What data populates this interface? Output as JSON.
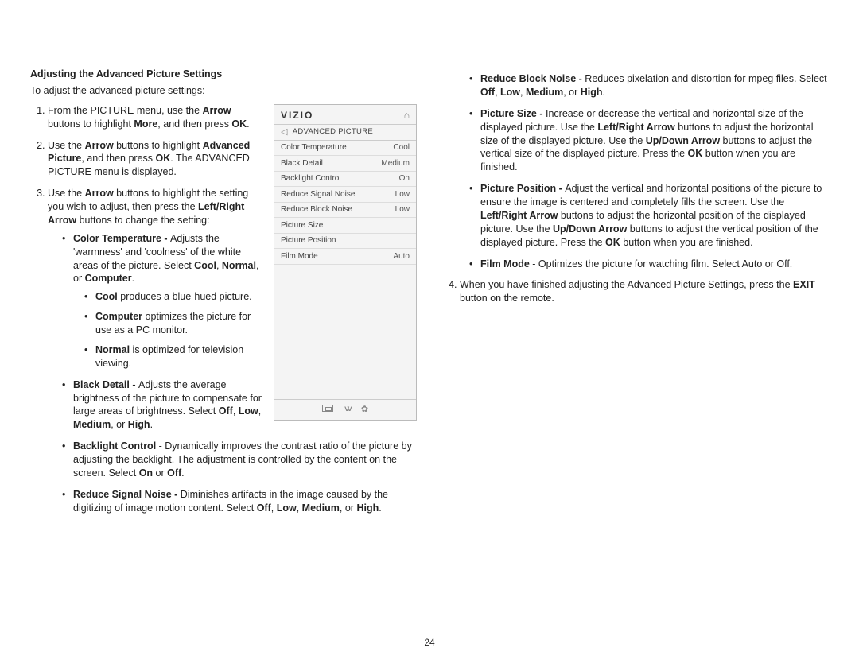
{
  "page_number": "24",
  "left": {
    "title": "Adjusting the Advanced Picture Settings",
    "intro": "To adjust the advanced picture settings:",
    "step1_a": "From the PICTURE menu, use the ",
    "step1_b": " buttons to highlight ",
    "step1_c": ", and then press ",
    "step1_d": ".",
    "arrow": "Arrow",
    "more": "More",
    "ok": "OK",
    "step2_a": "Use the ",
    "step2_b": " buttons to highlight ",
    "step2_c": ", and then press ",
    "step2_d": ". The ADVANCED PICTURE menu is displayed.",
    "adv_picture": "Advanced Picture",
    "step3_a": "Use the ",
    "step3_b": " buttons to highlight the setting you wish to adjust, then press the ",
    "step3_c": " buttons to change the setting:",
    "left_right_arrow": "Left/Right Arrow",
    "ct_label": "Color Temperature - ",
    "ct_text_a": "Adjusts the 'warmness' and 'coolness' of the white areas of the picture. Select ",
    "ct_text_b": ", ",
    "ct_text_c": ", or ",
    "ct_text_d": ".",
    "cool": "Cool",
    "normal": "Normal",
    "computer": "Computer",
    "cool_sub": " produces a blue-hued picture.",
    "computer_sub": " optimizes the picture for use as a PC monitor.",
    "normal_sub": " is optimized for television viewing.",
    "bd_label": "Black Detail - ",
    "bd_text_a": "Adjusts the average brightness of the picture to compensate for large areas of brightness. Select ",
    "bd_text_b": ", ",
    "bd_text_c": ", ",
    "bd_text_d": ", or ",
    "bd_text_e": ".",
    "off": "Off",
    "low": "Low",
    "medium": "Medium",
    "high": "High",
    "bl_label": "Backlight Control",
    "bl_text": " - Dynamically improves the contrast ratio of the picture by adjusting the backlight. The adjustment is controlled by the content on the screen. Select ",
    "bl_text_b": " or ",
    "bl_text_c": ".",
    "on": "On",
    "rsn_label": "Reduce Signal Noise - ",
    "rsn_text": "Diminishes artifacts in the image caused by the digitizing of image motion content. Select "
  },
  "right": {
    "rbn_label": "Reduce Block Noise - ",
    "rbn_text": "Reduces pixelation and distortion for mpeg files. Select ",
    "ps_label": "Picture Size - ",
    "ps_text_a": "Increase or decrease the vertical and horizontal size of the displayed picture. Use the ",
    "ps_text_b": " buttons to adjust the horizontal size of the displayed picture. Use the ",
    "ps_text_c": " buttons to adjust the vertical size of the displayed picture. Press the ",
    "ps_text_d": " button when you are finished.",
    "lr_arrow": "Left/Right Arrow",
    "ud_arrow": "Up/Down Arrow",
    "ok": "OK",
    "pp_label": "Picture Position - ",
    "pp_text_a": "Adjust the vertical and horizontal positions of the picture to ensure the image is centered and completely fills the screen. Use the ",
    "pp_text_b": " buttons to adjust the horizontal position of the displayed picture. Use the ",
    "pp_text_c": " buttons to adjust the vertical position of the displayed picture. Press the ",
    "pp_text_d": " button when you are finished.",
    "fm_label": "Film Mode",
    "fm_text": " - Optimizes the picture for watching film. Select Auto or Off.",
    "step4_a": "When you have finished adjusting the Advanced Picture Settings, press the ",
    "step4_b": " button on the remote.",
    "exit": "EXIT"
  },
  "menu": {
    "brand": "VIZIO",
    "title": "ADVANCED PICTURE",
    "rows": [
      {
        "label": "Color Temperature",
        "value": "Cool"
      },
      {
        "label": "Black Detail",
        "value": "Medium"
      },
      {
        "label": "Backlight Control",
        "value": "On"
      },
      {
        "label": "Reduce Signal Noise",
        "value": "Low"
      },
      {
        "label": "Reduce Block Noise",
        "value": "Low"
      },
      {
        "label": "Picture Size",
        "value": ""
      },
      {
        "label": "Picture Position",
        "value": ""
      },
      {
        "label": "Film Mode",
        "value": "Auto"
      }
    ]
  }
}
